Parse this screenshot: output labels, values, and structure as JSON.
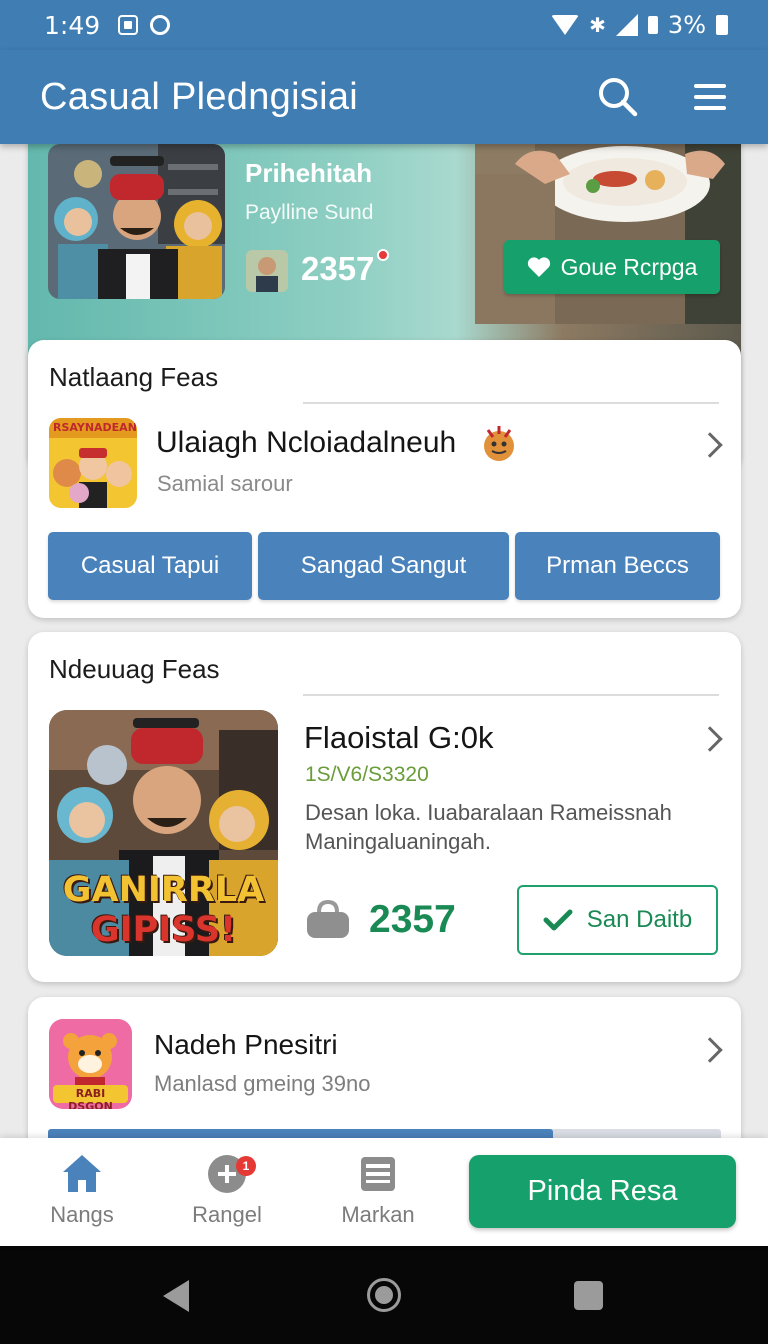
{
  "status_bar": {
    "time": "1:49",
    "battery": "3%"
  },
  "app_bar": {
    "title": "Casual Pledngisiai",
    "search_icon": "search-icon",
    "menu_icon": "menu-icon"
  },
  "hero": {
    "title": "Prihehitah",
    "subtitle": "Paylline Sund",
    "count": "2357",
    "button_label": "Goue Rcrpga",
    "button_color": "#16a06c"
  },
  "section1": {
    "heading": "Natlaang Feas",
    "thumb_caption": "RSAYNADEAN",
    "item_title": "Ulaiagh Ncloiadalneuh",
    "item_subtitle": "Samial sarour",
    "chips": [
      "Casual Tapui",
      "Sangad Sangut",
      "Prman Beccs"
    ]
  },
  "section2": {
    "heading": "Ndeuuag Feas",
    "poster_text_line1": "GANIRRLA",
    "poster_text_line2": "GIPISS!",
    "item_title": "Flaoistal G:0k",
    "price": "1S/V6/S3320",
    "description": "Desan loka. Iuabaralaan Rameissnah Maningaluaningah.",
    "count": "2357",
    "button_label": "San Daitb"
  },
  "section3": {
    "thumb_caption": "RABI DSGON",
    "item_title": "Nadeh Pnesitri",
    "item_subtitle": "Manlasd gmeing 39no",
    "progress": 0.75
  },
  "bottom_nav": {
    "items": [
      {
        "label": "Nangs",
        "icon": "home-icon"
      },
      {
        "label": "Rangel",
        "icon": "add-circle-icon",
        "badge": "1"
      },
      {
        "label": "Markan",
        "icon": "wallet-icon"
      }
    ],
    "cta_label": "Pinda Resa"
  },
  "colors": {
    "primary": "#3f7db3",
    "accent_green": "#16a06c",
    "chip_blue": "#4a82bb"
  }
}
